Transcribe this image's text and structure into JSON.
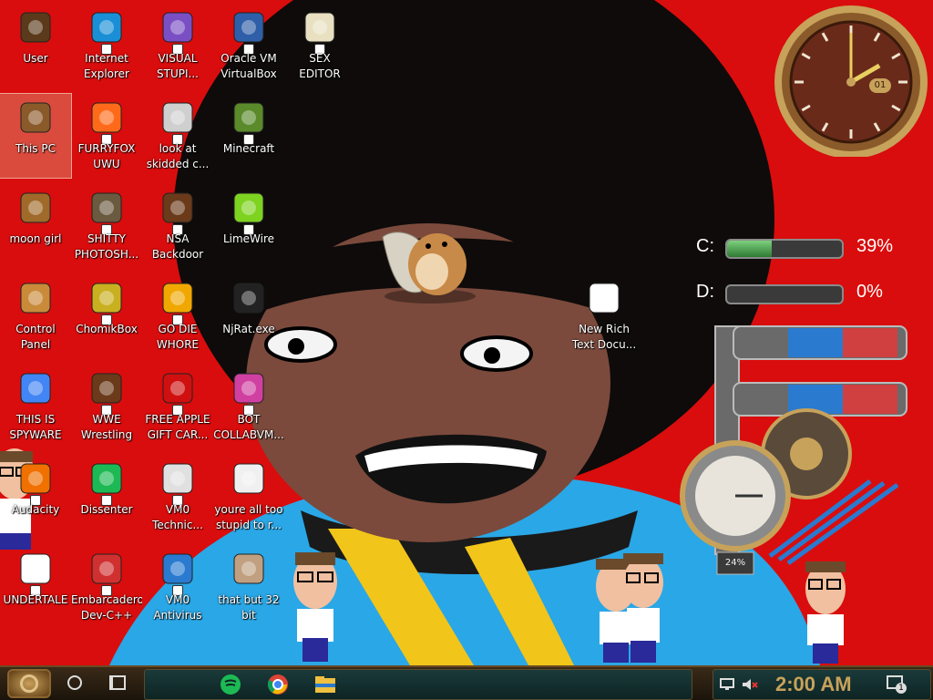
{
  "desktop": {
    "icons": [
      {
        "id": "user",
        "label": "User",
        "icon": "folder-user-icon",
        "col": 0,
        "row": 0,
        "color": "#5a3a1a",
        "shortcut": false
      },
      {
        "id": "internet-explorer",
        "label": "Internet\nExplorer",
        "icon": "edge-icon",
        "col": 1,
        "row": 0,
        "color": "#1a8fd6",
        "shortcut": true
      },
      {
        "id": "visual-studio",
        "label": "VISUAL\nSTUPI...",
        "icon": "visual-studio-icon",
        "col": 2,
        "row": 0,
        "color": "#7b4fc4",
        "shortcut": true
      },
      {
        "id": "virtualbox",
        "label": "Oracle VM\nVirtualBox",
        "icon": "virtualbox-icon",
        "col": 3,
        "row": 0,
        "color": "#2f5fa8",
        "shortcut": true
      },
      {
        "id": "hex-editor",
        "label": "SEX\nEDITOR",
        "icon": "hex-editor-icon",
        "col": 4,
        "row": 0,
        "color": "#e8e0c0",
        "shortcut": true
      },
      {
        "id": "this-pc",
        "label": "This PC",
        "icon": "this-pc-icon",
        "col": 0,
        "row": 1,
        "color": "#8a5a2a",
        "shortcut": false,
        "selected": true
      },
      {
        "id": "firefox",
        "label": "FURRYFOX\nUWU",
        "icon": "firefox-icon",
        "col": 1,
        "row": 1,
        "color": "#ff6a1a",
        "shortcut": true
      },
      {
        "id": "skidded-code",
        "label": "look at\nskidded c...",
        "icon": "files-stack-icon",
        "col": 2,
        "row": 1,
        "color": "#cfcfcf",
        "shortcut": true
      },
      {
        "id": "minecraft",
        "label": "Minecraft",
        "icon": "minecraft-grass-block-icon",
        "col": 3,
        "row": 1,
        "color": "#5a8a2a",
        "shortcut": true
      },
      {
        "id": "moon-girl",
        "label": "moon girl",
        "icon": "folder-icon",
        "col": 0,
        "row": 2,
        "color": "#a06a2a",
        "shortcut": false
      },
      {
        "id": "gimp",
        "label": "SHITTY\nPHOTOSH...",
        "icon": "gimp-icon",
        "col": 1,
        "row": 2,
        "color": "#6a5a40",
        "shortcut": true
      },
      {
        "id": "nsa-backdoor",
        "label": "NSA\nBackdoor",
        "icon": "steampunk-frame-icon",
        "col": 2,
        "row": 2,
        "color": "#6a3a1a",
        "shortcut": true
      },
      {
        "id": "limewire",
        "label": "LimeWire",
        "icon": "limewire-icon",
        "col": 3,
        "row": 2,
        "color": "#7ed321",
        "shortcut": true
      },
      {
        "id": "control-panel",
        "label": "Control Panel",
        "icon": "control-panel-icon",
        "col": 0,
        "row": 3,
        "color": "#c98a3a",
        "shortcut": false
      },
      {
        "id": "chomikbox",
        "label": "ChomikBox",
        "icon": "chomikbox-icon",
        "col": 1,
        "row": 3,
        "color": "#c8b020",
        "shortcut": true
      },
      {
        "id": "go-die-whore",
        "label": "GO DIE\nWHORE",
        "icon": "dependency-walker-icon",
        "col": 2,
        "row": 3,
        "color": "#f0a800",
        "shortcut": true
      },
      {
        "id": "njrat",
        "label": "NjRat.exe",
        "icon": "skull-icon",
        "col": 3,
        "row": 3,
        "color": "#222222",
        "shortcut": false
      },
      {
        "id": "chrome",
        "label": "THIS IS\nSPYWARE",
        "icon": "chrome-icon",
        "col": 0,
        "row": 4,
        "color": "#4285f4",
        "shortcut": false
      },
      {
        "id": "wwe-wrestling",
        "label": "WWE\nWrestling",
        "icon": "steampunk-window-icon",
        "col": 1,
        "row": 4,
        "color": "#6a3a1a",
        "shortcut": true
      },
      {
        "id": "free-apple",
        "label": "FREE APPLE\nGIFT CAR...",
        "icon": "apple-icon",
        "col": 2,
        "row": 4,
        "color": "#d01010",
        "shortcut": true
      },
      {
        "id": "bot-collabvm",
        "label": "BOT\nCOLLABVM...",
        "icon": "monitor-pink-icon",
        "col": 3,
        "row": 4,
        "color": "#d040a0",
        "shortcut": true
      },
      {
        "id": "audacity",
        "label": "Audacity",
        "icon": "audacity-icon",
        "col": 0,
        "row": 5,
        "color": "#f07000",
        "shortcut": true
      },
      {
        "id": "dissenter",
        "label": "Dissenter",
        "icon": "spotify-green-icon",
        "col": 1,
        "row": 5,
        "color": "#1db954",
        "shortcut": true
      },
      {
        "id": "vmo-technician",
        "label": "VM0\nTechnic...",
        "icon": "doctor-icon",
        "col": 2,
        "row": 5,
        "color": "#e0e0e0",
        "shortcut": true
      },
      {
        "id": "youre-all-too-stupid",
        "label": "youre all too\nstupid to r...",
        "icon": "portrait-bw-icon",
        "col": 3,
        "row": 5,
        "color": "#f0f0f0",
        "shortcut": false
      },
      {
        "id": "undertale",
        "label": "UNDERTALE",
        "icon": "unity-icon",
        "col": 0,
        "row": 6,
        "color": "#ffffff",
        "shortcut": true
      },
      {
        "id": "dev-cpp",
        "label": "Embarcadero\nDev-C++",
        "icon": "dev-cpp-icon",
        "col": 1,
        "row": 6,
        "color": "#d03030",
        "shortcut": true
      },
      {
        "id": "vmo-antivirus",
        "label": "VM0\nAntivirus",
        "icon": "windows-shield-icon",
        "col": 2,
        "row": 6,
        "color": "#2a7ad0",
        "shortcut": true
      },
      {
        "id": "that-but-32-bit",
        "label": "that but 32\nbit",
        "icon": "portrait-painting-icon",
        "col": 3,
        "row": 6,
        "color": "#c0a080",
        "shortcut": false
      },
      {
        "id": "new-rich-text",
        "label": "New Rich\nText Docu...",
        "icon": "rtf-document-icon",
        "col": 8,
        "row": 3,
        "color": "#ffffff",
        "shortcut": false
      }
    ]
  },
  "widgets": {
    "clock": {
      "hour": 2,
      "minute": 0,
      "day": "01"
    },
    "drives": [
      {
        "letter": "C:",
        "percent_text": "39%",
        "fraction": 0.39
      },
      {
        "letter": "D:",
        "percent_text": "0%",
        "fraction": 0.0
      }
    ],
    "gauge_percent": "24%"
  },
  "taskbar": {
    "pinned": [
      {
        "name": "taskbar-spotify-icon",
        "color": "#1db954"
      },
      {
        "name": "taskbar-chrome-icon",
        "color": "#4285f4"
      },
      {
        "name": "taskbar-file-explorer-icon",
        "color": "#f0c040"
      }
    ],
    "time": "2:00 AM",
    "notification_count": "1"
  },
  "colors": {
    "desktop_bg": "#d90d0d",
    "brass": "#c7a25a"
  }
}
